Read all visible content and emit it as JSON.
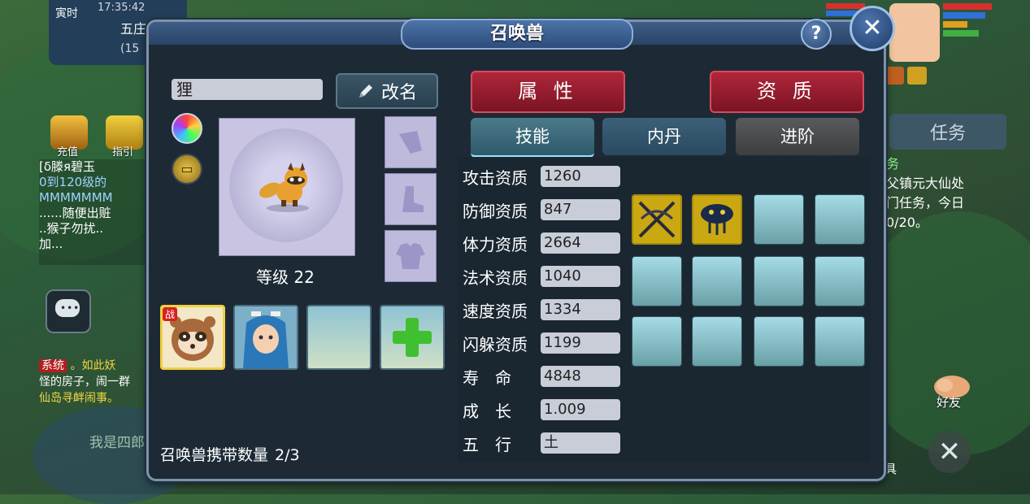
{
  "background": {
    "hud": {
      "period": "寅时",
      "time": "17:35:42",
      "place": "五庄",
      "coord": "(15"
    },
    "chat_lines": [
      "[δ滕я碧玉",
      "0到120级的",
      "MMMMMMM",
      "......随便出赃",
      "..猴子勿扰..",
      "加..."
    ],
    "system_chat": {
      "tag": "系统",
      "line1": "。如此妖",
      "line2": "怪的房子，闹一群",
      "line3": "仙岛寻衅闹事。"
    },
    "left_icons": [
      {
        "label": "充值",
        "icon": "recharge-icon"
      },
      {
        "label": "指引",
        "icon": "guide-icon"
      }
    ],
    "bottom_hint": "我是四郎",
    "right_tab": "任务",
    "right_task_lines": [
      "务",
      "父镇元大仙处",
      "门任务，今日",
      "0/20。"
    ],
    "friend_label": "好友",
    "tool_label": "具"
  },
  "dialog": {
    "title": "召唤兽",
    "pet_name": "狸",
    "rename_label": "改名",
    "level_label": "等级",
    "level_value": "22",
    "carry_label": "召唤兽携带数量",
    "carry_value": "2/3",
    "tabs_main": [
      "属 性",
      "资 质"
    ],
    "tabs_sub": [
      "技能",
      "内丹",
      "进阶"
    ],
    "stats": [
      {
        "label": "攻击资质",
        "value": "1260"
      },
      {
        "label": "防御资质",
        "value": "847"
      },
      {
        "label": "体力资质",
        "value": "2664"
      },
      {
        "label": "法术资质",
        "value": "1040"
      },
      {
        "label": "速度资质",
        "value": "1334"
      },
      {
        "label": "闪躲资质",
        "value": "1199"
      },
      {
        "label": "寿　命",
        "value": "4848"
      },
      {
        "label": "成　长",
        "value": "1.009"
      },
      {
        "label": "五　行",
        "value": "土"
      }
    ],
    "pet_slot_war_tag": "战",
    "skills": [
      "crossed-swords-icon",
      "snake-mask-icon",
      "",
      "",
      "",
      "",
      "",
      "",
      "",
      "",
      "",
      ""
    ],
    "colors": {
      "primary_tab": "#b0263a",
      "panel": "#1d2a35",
      "field": "#c9cdd8"
    }
  }
}
